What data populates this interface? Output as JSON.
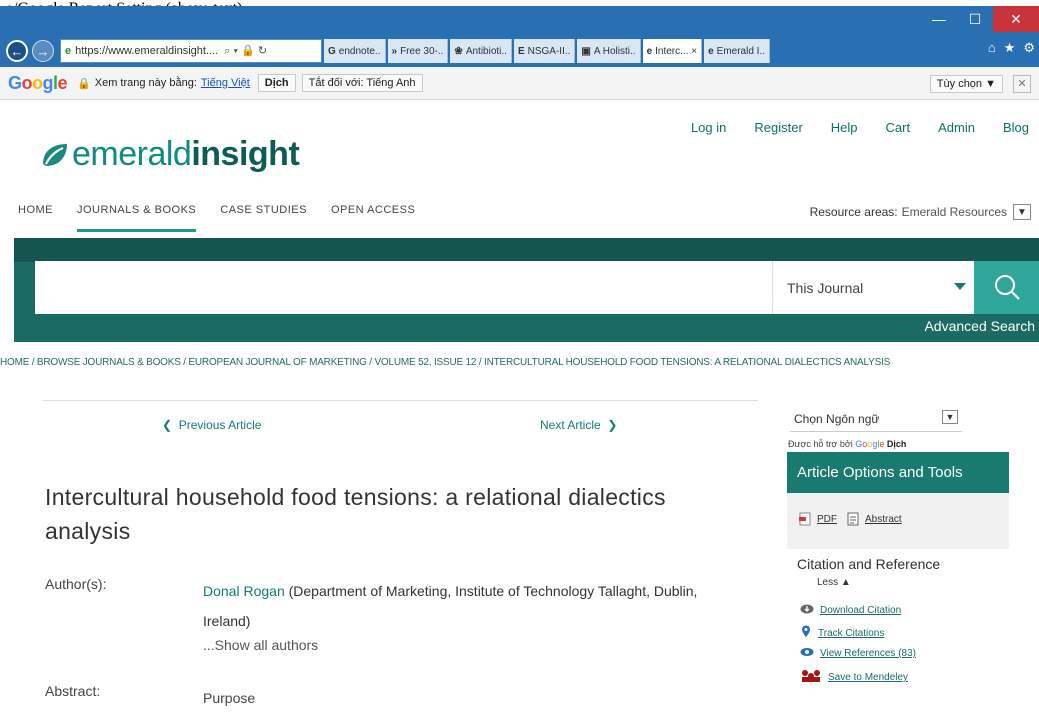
{
  "top_text": "e/Google Report Setting (above text),",
  "browser": {
    "address": "https://www.emeraldinsight....",
    "address_controls": "⌕ ▾ 🔒 ↻",
    "tabs": [
      {
        "icon": "G",
        "label": "endnote..",
        "active": false
      },
      {
        "icon": "»",
        "label": "Free 30-..",
        "active": false
      },
      {
        "icon": "❀",
        "label": "Antibioti..",
        "active": false
      },
      {
        "icon": "E",
        "label": "NSGA-II..",
        "active": false
      },
      {
        "icon": "▣",
        "label": "A Holisti..",
        "active": false
      },
      {
        "icon": "e",
        "label": "Interc... ×",
        "active": true
      },
      {
        "icon": "e",
        "label": "Emerald I..",
        "active": false
      }
    ],
    "window_buttons": {
      "minimize": "—",
      "maximize": "☐",
      "close": "✕"
    }
  },
  "google_bar": {
    "view_page_in": "Xem trang này bằng:",
    "language": "Tiếng Việt",
    "translate": "Dịch",
    "always": "Tắt đối với: Tiếng Anh",
    "options": "Tùy chọn ▼",
    "close": "✕"
  },
  "site": {
    "logo_regular": "emerald",
    "logo_bold": "insight",
    "top_links": [
      "Log in",
      "Register",
      "Help",
      "Cart",
      "Admin",
      "Blog"
    ],
    "main_nav": [
      "HOME",
      "JOURNALS & BOOKS",
      "CASE STUDIES",
      "OPEN ACCESS"
    ],
    "resource_label": "Resource areas:",
    "resource_value": "Emerald Resources",
    "search_scope": "This Journal",
    "advanced_search": "Advanced Search",
    "breadcrumb": "HOME / BROWSE JOURNALS & BOOKS / EUROPEAN JOURNAL OF MARKETING / VOLUME 52, ISSUE 12 / INTERCULTURAL HOUSEHOLD FOOD TENSIONS: A RELATIONAL DIALECTICS ANALYSIS"
  },
  "article": {
    "prev": "Previous Article",
    "next": "Next Article",
    "title": "Intercultural household food tensions: a relational dialectics analysis",
    "authors_label": "Author(s):",
    "author_name": "Donal Rogan",
    "author_affil": " (Department of Marketing, Institute of Technology Tallaght, Dublin, Ireland)",
    "show_all": "...Show all authors",
    "abstract_label": "Abstract:",
    "abstract_first": "Purpose"
  },
  "sidebar": {
    "lang_select": "Chọn Ngôn ngữ",
    "powered_by": "Được hỗ trợ bởi",
    "translate": "Dịch",
    "options_title": "Article Options and Tools",
    "pdf": "PDF",
    "abstract": "Abstract",
    "citation_title": "Citation and Reference",
    "less": "Less ▲",
    "links": [
      "Download Citation",
      "Track Citations",
      "View References (83)",
      "Save to Mendeley"
    ]
  },
  "colors": {
    "brand": "#1b7a70",
    "chrome": "#2a6fb1"
  }
}
